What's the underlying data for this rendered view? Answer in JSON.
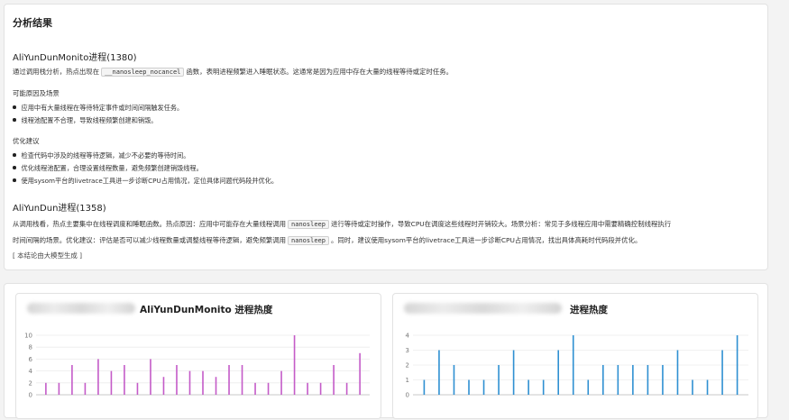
{
  "panel": {
    "title": "分析结果",
    "sections": [
      {
        "heading": "AliYunDunMonito进程(1380)",
        "intro_pre": "通过调用栈分析，热点出现在",
        "intro_code": "__nanosleep_nocancel",
        "intro_post": "函数，表明进程频繁进入睡眠状态。这通常是因为应用中存在大量的线程等待或定时任务。",
        "causes_title": "可能原因及场景",
        "causes": [
          "应用中有大量线程在等待特定事件或时间间隔触发任务。",
          "线程池配置不合理，导致线程频繁创建和销毁。"
        ],
        "suggest_title": "优化建议",
        "suggestions": [
          "检查代码中涉及的线程等待逻辑，减少不必要的等待时间。",
          "优化线程池配置，合理设置线程数量，避免频繁创建销毁线程。",
          "使用sysom平台的livetrace工具进一步诊断CPU占用情况，定位具体问题代码段并优化。"
        ]
      },
      {
        "heading": "AliYunDun进程(1358)",
        "line1_pre": "从调用栈看，热点主要集中在线程调度和睡眠函数。热点原因：应用中可能存在大量线程调用",
        "line1_code": "nanosleep",
        "line1_post": "进行等待或定时操作，导致CPU在调度这些线程时开销较大。场景分析：常见于多线程应用中需要精确控制线程执行",
        "line2_pre": "时间间隔的场景。优化建议：评估是否可以减少线程数量或调整线程等待逻辑，避免频繁调用",
        "line2_code": "nanosleep",
        "line2_post": "。同时，建议使用sysom平台的livetrace工具进一步诊断CPU占用情况，找出具体高耗时代码段并优化。",
        "note": "[ 本结论由大模型生成 ]"
      }
    ]
  },
  "charts": [
    {
      "title": "AliYunDunMonito  进程热度",
      "color": "#c45bc8",
      "chart_data": {
        "type": "bar",
        "title": "AliYunDunMonito  进程热度",
        "ylim": [
          0,
          10
        ],
        "yticks": [
          0,
          2,
          4,
          6,
          8,
          10
        ],
        "values": [
          2,
          2,
          5,
          2,
          6,
          4,
          5,
          2,
          6,
          3,
          5,
          4,
          4,
          3,
          5,
          5,
          2,
          2,
          4,
          10,
          2,
          2,
          5,
          2,
          7
        ]
      }
    },
    {
      "title": "进程热度",
      "color": "#2f90d2",
      "chart_data": {
        "type": "bar",
        "title": "进程热度",
        "ylim": [
          0,
          4
        ],
        "yticks": [
          0,
          1,
          2,
          3,
          4
        ],
        "values": [
          1,
          3,
          2,
          1,
          1,
          2,
          3,
          1,
          1,
          3,
          4,
          1,
          2,
          2,
          2,
          2,
          2,
          3,
          1,
          1,
          3,
          4
        ]
      }
    }
  ]
}
